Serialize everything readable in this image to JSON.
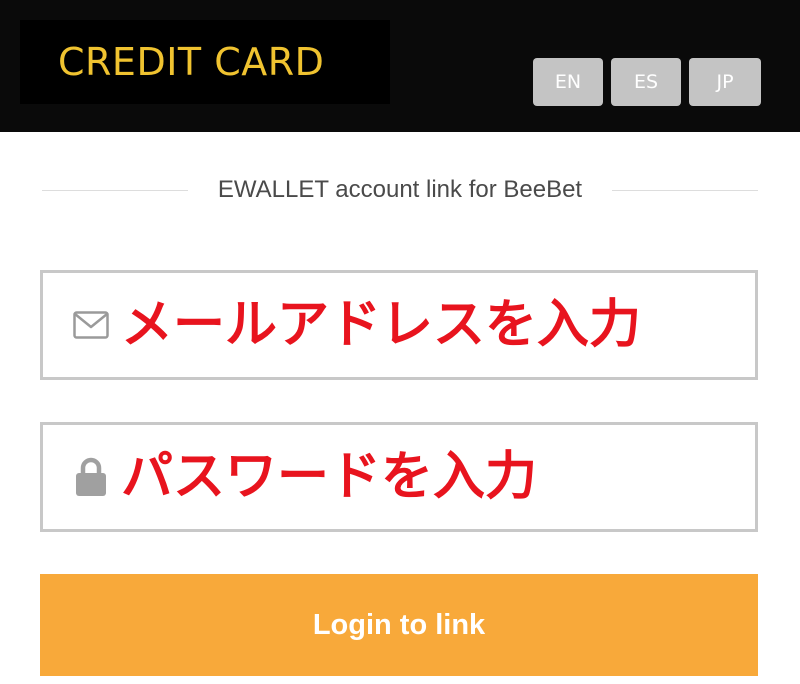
{
  "header": {
    "brand_text": "CREDIT CARD",
    "languages": [
      {
        "label": "EN"
      },
      {
        "label": "ES"
      },
      {
        "label": "JP"
      }
    ]
  },
  "section": {
    "title": "EWALLET account link for BeeBet"
  },
  "form": {
    "email": {
      "icon": "envelope-icon",
      "placeholder": "メールアドレスを入力"
    },
    "password": {
      "icon": "lock-icon",
      "placeholder": "パスワードを入力"
    },
    "submit_label": "Login to link"
  },
  "colors": {
    "header_bg": "#0a0a0a",
    "brand_text": "#f0c330",
    "language_button": "#c4c4c4",
    "field_border": "#c8c8c8",
    "placeholder_text": "#e8141e",
    "button_bg": "#f8a93a",
    "button_text": "#ffffff"
  }
}
